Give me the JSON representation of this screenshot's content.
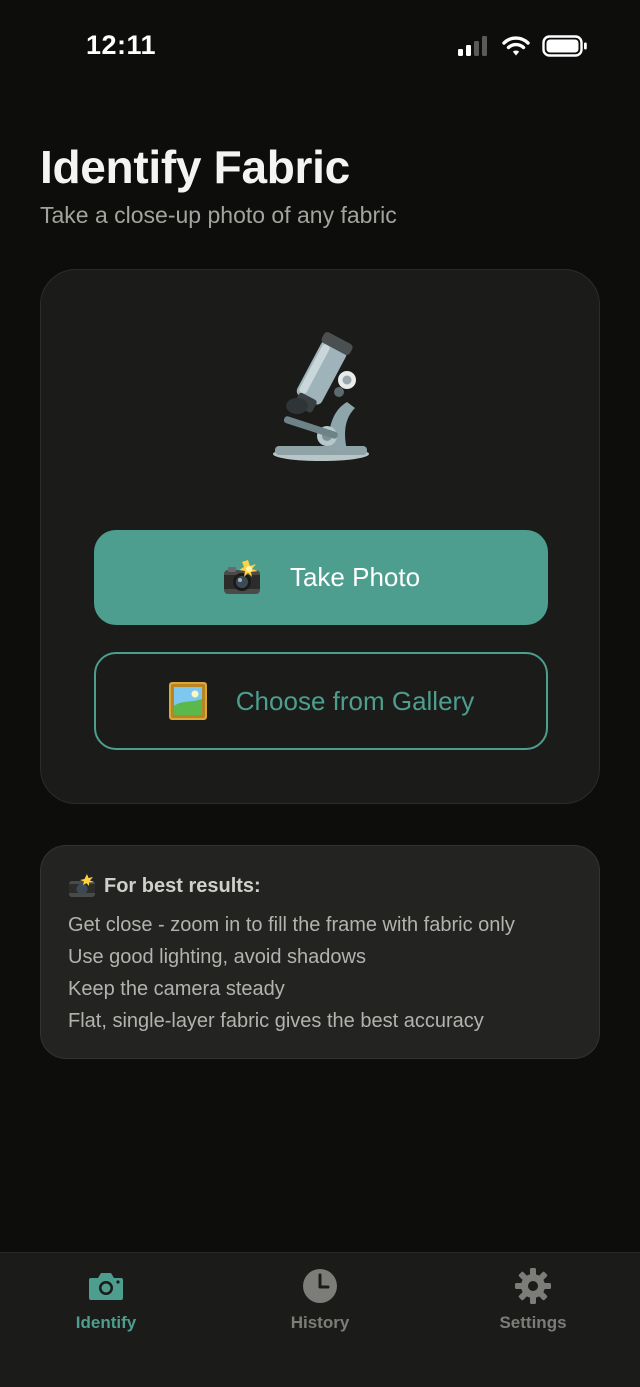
{
  "status_bar": {
    "time": "12:11",
    "icons": [
      "cellular-signal-icon",
      "wifi-icon",
      "battery-icon"
    ]
  },
  "header": {
    "title": "Identify Fabric",
    "subtitle": "Take a close-up photo of any fabric"
  },
  "main_card": {
    "illustration": "microscope-icon",
    "take_photo_label": "Take Photo",
    "take_photo_icon": "camera-flash-icon",
    "gallery_label": "Choose from Gallery",
    "gallery_icon": "framed-picture-icon"
  },
  "tips": {
    "icon": "camera-flash-icon",
    "title": "For best results:",
    "items": [
      "Get close - zoom in to fill the frame with fabric only",
      "Use good lighting, avoid shadows",
      "Keep the camera steady",
      "Flat, single-layer fabric gives the best accuracy"
    ]
  },
  "tab_bar": {
    "items": [
      {
        "label": "Identify",
        "icon": "camera-icon",
        "active": true
      },
      {
        "label": "History",
        "icon": "clock-icon",
        "active": false
      },
      {
        "label": "Settings",
        "icon": "gear-icon",
        "active": false
      }
    ]
  },
  "colors": {
    "background": "#0d0d0c",
    "card": "#1b1b19",
    "accent": "#4d9e8f",
    "inactive_tab": "#7c7c78"
  }
}
